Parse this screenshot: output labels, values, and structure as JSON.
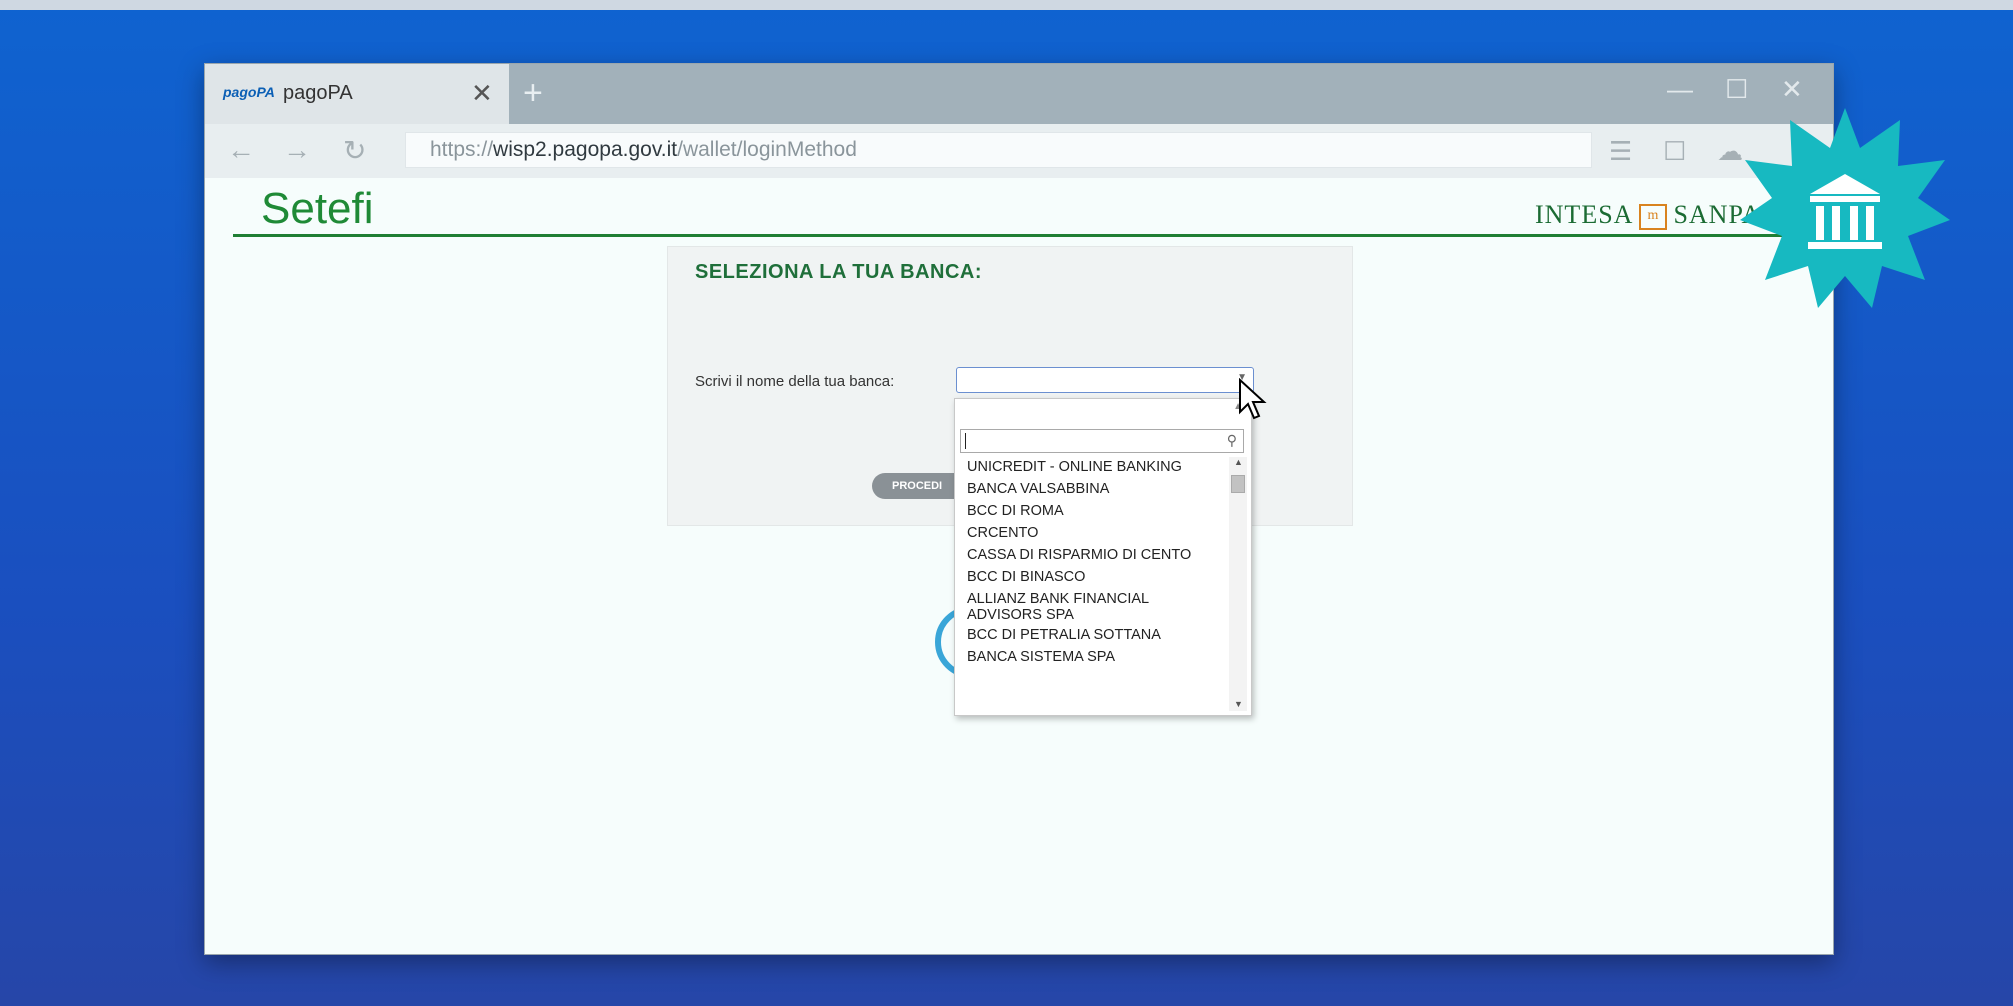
{
  "browser": {
    "tab_logo": "pagoPA",
    "tab_title": "pagoPA",
    "url_scheme": "https://",
    "url_host": "wisp2.pagopa.gov.it",
    "url_path": "/wallet/loginMethod"
  },
  "page": {
    "brand": "Setefi",
    "bank_logo_left": "INTESA",
    "bank_logo_right": "SANPA",
    "panel_title": "SELEZIONA LA TUA BANCA:",
    "field_label": "Scrivi il nome della tua banca:",
    "proceed_label": "PROCEDI"
  },
  "dropdown": {
    "search_value": "",
    "items": [
      "UNICREDIT - ONLINE BANKING",
      "BANCA VALSABBINA",
      "BCC DI ROMA",
      "CRCENTO",
      "CASSA DI RISPARMIO DI CENTO",
      "BCC DI BINASCO",
      "ALLIANZ BANK FINANCIAL ADVISORS SPA",
      "BCC DI PETRALIA SOTTANA",
      "BANCA SISTEMA SPA"
    ]
  },
  "colors": {
    "brand_green": "#1f8a36",
    "badge_teal": "#17b9c1",
    "background_blue": "#1a4fbf"
  },
  "icons": {
    "badge": "bank-icon"
  }
}
